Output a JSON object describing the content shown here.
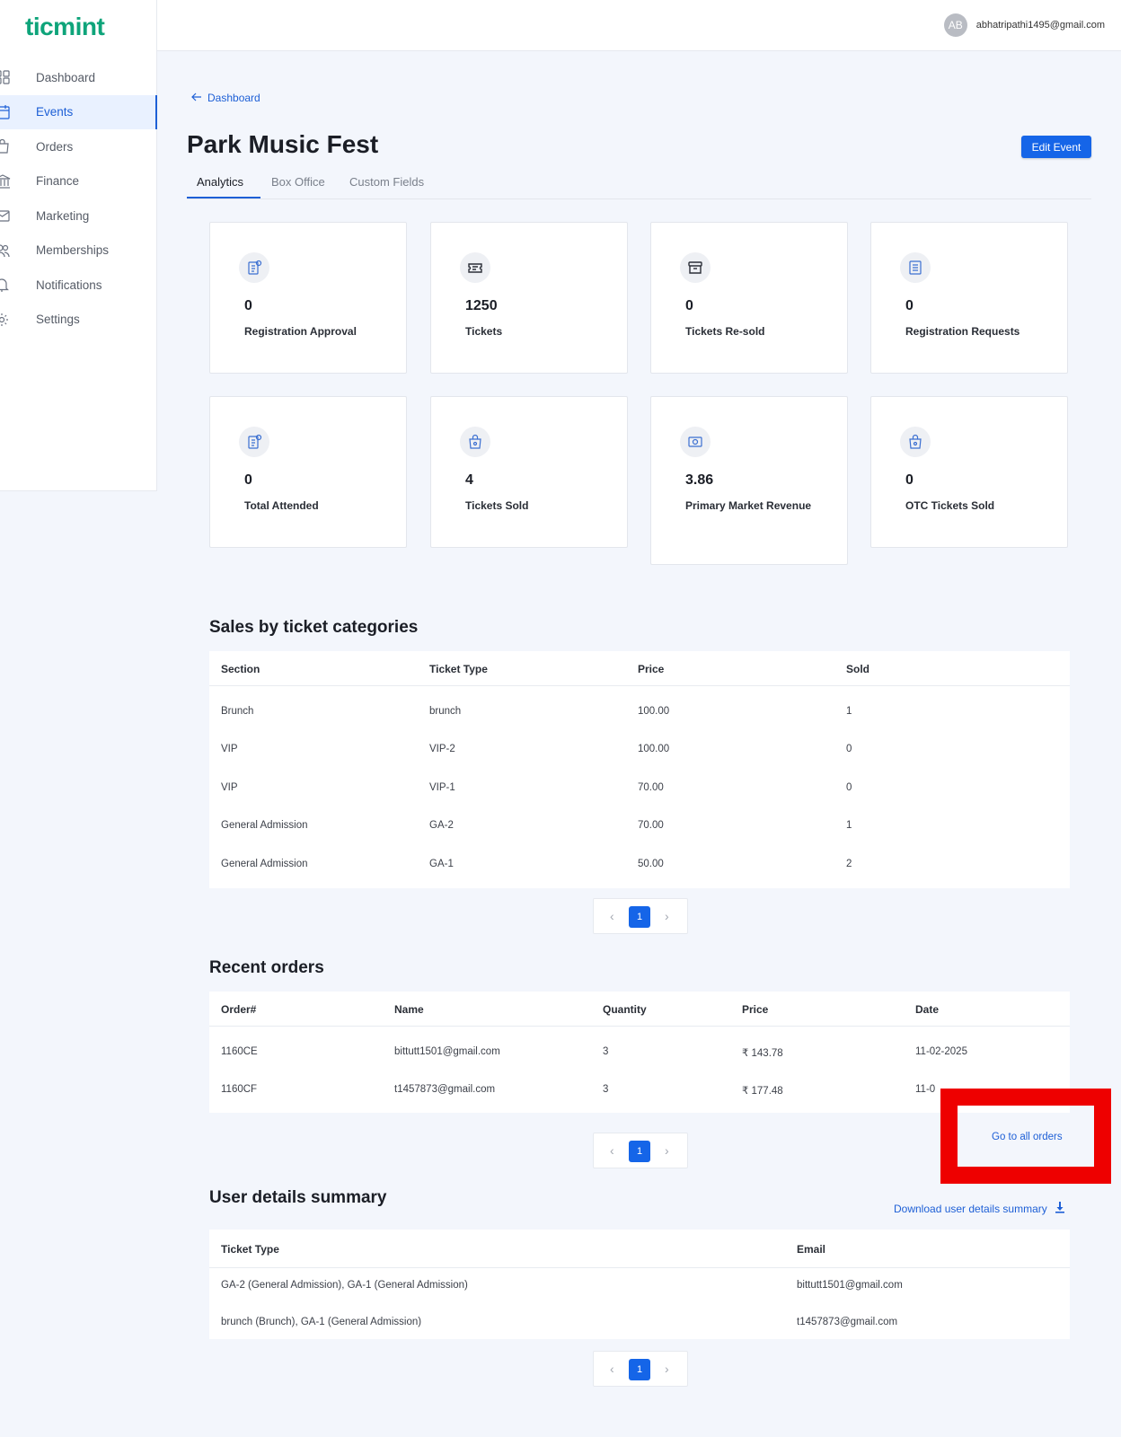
{
  "brand": {
    "logo_text": "ticmint",
    "accent": "#0ea47a",
    "primary": "#1565e8"
  },
  "header": {
    "avatar_initials": "AB",
    "user_email": "abhatripathi1495@gmail.com"
  },
  "sidebar": {
    "items": [
      {
        "label": "Dashboard",
        "icon": "grid-icon"
      },
      {
        "label": "Events",
        "icon": "calendar-icon",
        "active": true
      },
      {
        "label": "Orders",
        "icon": "shopping-bag-icon"
      },
      {
        "label": "Finance",
        "icon": "bank-icon"
      },
      {
        "label": "Marketing",
        "icon": "mail-icon"
      },
      {
        "label": "Memberships",
        "icon": "users-icon"
      },
      {
        "label": "Notifications",
        "icon": "bell-icon"
      },
      {
        "label": "Settings",
        "icon": "gear-icon"
      }
    ]
  },
  "breadcrumb": {
    "back_label": "Dashboard"
  },
  "event": {
    "title": "Park Music Fest",
    "edit_label": "Edit Event"
  },
  "tabs": [
    {
      "label": "Analytics",
      "active": true
    },
    {
      "label": "Box Office"
    },
    {
      "label": "Custom Fields"
    }
  ],
  "stats": [
    {
      "value": "0",
      "label": "Registration Approval",
      "icon": "clipboard-icon"
    },
    {
      "value": "1250",
      "label": "Tickets",
      "icon": "ticket-icon"
    },
    {
      "value": "0",
      "label": "Tickets Re-sold",
      "icon": "archive-icon"
    },
    {
      "value": "0",
      "label": "Registration Requests",
      "icon": "list-icon"
    },
    {
      "value": "0",
      "label": "Total Attended",
      "icon": "clipboard-icon"
    },
    {
      "value": "4",
      "label": "Tickets Sold",
      "icon": "bag-icon"
    },
    {
      "value": "3.86",
      "label": "Primary Market Revenue",
      "icon": "cash-icon"
    },
    {
      "value": "0",
      "label": "OTC Tickets Sold",
      "icon": "bag-icon"
    }
  ],
  "sales": {
    "title": "Sales by ticket categories",
    "columns": [
      "Section",
      "Ticket Type",
      "Price",
      "Sold"
    ],
    "rows": [
      [
        "Brunch",
        "brunch",
        "100.00",
        "1"
      ],
      [
        "VIP",
        "VIP-2",
        "100.00",
        "0"
      ],
      [
        "VIP",
        "VIP-1",
        "70.00",
        "0"
      ],
      [
        "General Admission",
        "GA-2",
        "70.00",
        "1"
      ],
      [
        "General Admission",
        "GA-1",
        "50.00",
        "2"
      ]
    ],
    "page": "1"
  },
  "orders": {
    "title": "Recent orders",
    "columns": [
      "Order#",
      "Name",
      "Quantity",
      "Price",
      "Date"
    ],
    "rows": [
      [
        "1160CE",
        "bittutt1501@gmail.com",
        "3",
        "₹ 143.78",
        "11-02-2025"
      ],
      [
        "1160CF",
        "t1457873@gmail.com",
        "3",
        "₹ 177.48",
        "11-0"
      ]
    ],
    "go_all_label": "Go to all orders",
    "page": "1"
  },
  "user_summary": {
    "title": "User details summary",
    "download_label": "Download user details summary",
    "columns": [
      "Ticket Type",
      "Email"
    ],
    "rows": [
      [
        "GA-2 (General Admission), GA-1 (General Admission)",
        "bittutt1501@gmail.com"
      ],
      [
        "brunch (Brunch), GA-1 (General Admission)",
        "t1457873@gmail.com"
      ]
    ],
    "page": "1"
  }
}
